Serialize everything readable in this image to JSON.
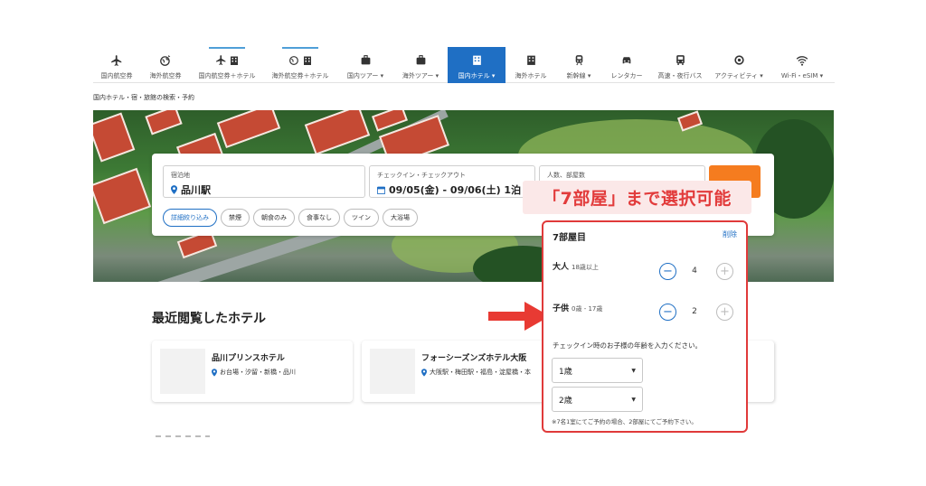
{
  "nav": {
    "items": [
      {
        "label": "国内航空券",
        "icon": "airplane-icon"
      },
      {
        "label": "海外航空券",
        "icon": "globe-plane-icon"
      },
      {
        "label": "国内航空券＋ホテル",
        "icon": "plane-hotel-icon"
      },
      {
        "label": "海外航空券＋ホテル",
        "icon": "globe-hotel-icon"
      },
      {
        "label": "国内ツアー ▾",
        "icon": "suitcase-icon"
      },
      {
        "label": "海外ツアー ▾",
        "icon": "suitcase-icon"
      },
      {
        "label": "国内ホテル ▾",
        "icon": "hotel-icon"
      },
      {
        "label": "海外ホテル",
        "icon": "hotel-icon"
      },
      {
        "label": "新幹線 ▾",
        "icon": "train-icon"
      },
      {
        "label": "レンタカー",
        "icon": "car-icon"
      },
      {
        "label": "高速・夜行バス",
        "icon": "bus-icon"
      },
      {
        "label": "アクティビティ ▾",
        "icon": "activity-icon"
      },
      {
        "label": "Wi-Fi・eSIM ▾",
        "icon": "wifi-icon"
      }
    ],
    "active_index": 6
  },
  "breadcrumb": "国内ホテル・宿・旅館の検索・予約",
  "search": {
    "destination": {
      "label": "宿泊地",
      "value": "品川駅"
    },
    "dates": {
      "label": "チェックイン・チェックアウト",
      "value": "09/05(金) - 09/06(土) 1泊"
    },
    "guests": {
      "label": "人数、部屋数"
    },
    "filters": [
      "詳細絞り込み",
      "禁煙",
      "朝食のみ",
      "食事なし",
      "ツイン",
      "大浴場"
    ]
  },
  "callout": "「7部屋」まで選択可能",
  "room_panel": {
    "title": "7部屋目",
    "delete_label": "削除",
    "adults": {
      "label": "大人",
      "sub": "18歳以上",
      "value": "4"
    },
    "children": {
      "label": "子供",
      "sub": "0歳 - 17歳",
      "value": "2"
    },
    "instruction": "チェックイン時のお子様の年齢を入力ください。",
    "child_ages": [
      "1歳",
      "2歳"
    ],
    "note": "※7名1室にてご予約の場合、2部屋にてご予約下さい。"
  },
  "recent": {
    "title": "最近閲覧したホテル",
    "hotels": [
      {
        "name": "品川プリンスホテル",
        "location": "お台場・汐留・新橋・品川"
      },
      {
        "name": "フォーシーズンズホテル大阪",
        "location": "大阪駅・梅田駅・福島・淀屋橋・本"
      }
    ]
  },
  "colors": {
    "accent": "#1f6fc4",
    "highlight": "#e03a3a",
    "search_button": "#f57c1f"
  }
}
